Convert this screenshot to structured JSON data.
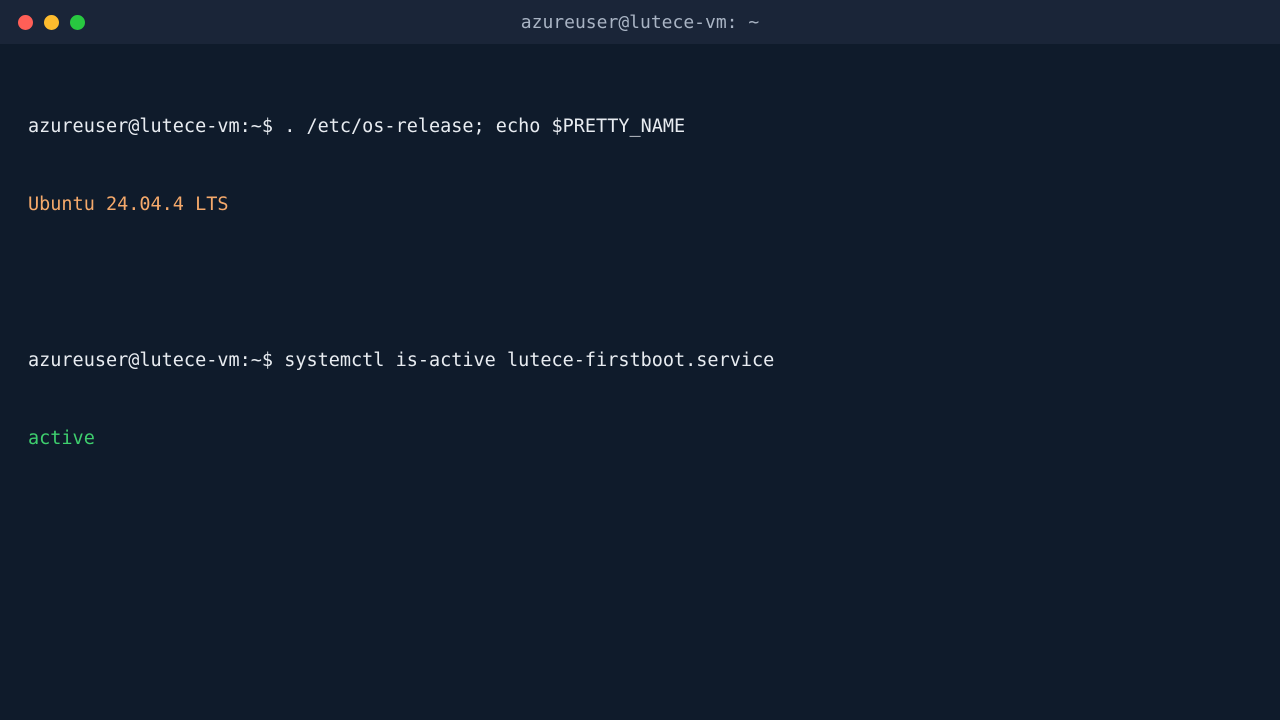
{
  "window": {
    "title": "azureuser@lutece-vm: ~"
  },
  "terminal": {
    "prompt": "azureuser@lutece-vm:~$",
    "commands": [
      {
        "command": ". /etc/os-release; echo $PRETTY_NAME",
        "output": "Ubuntu 24.04.4 LTS"
      },
      {
        "command": "systemctl is-active lutece-firstboot.service",
        "output": "active"
      }
    ]
  },
  "colors": {
    "background": "#0f1b2b",
    "titlebar": "#1a2538",
    "text": "#e8ecf1",
    "os_output": "#f5a96b",
    "status_active": "#3ecf6e",
    "close": "#ff5f57",
    "minimize": "#febc2e",
    "maximize": "#28c840"
  },
  "icons": [
    "close-icon",
    "minimize-icon",
    "maximize-icon"
  ]
}
